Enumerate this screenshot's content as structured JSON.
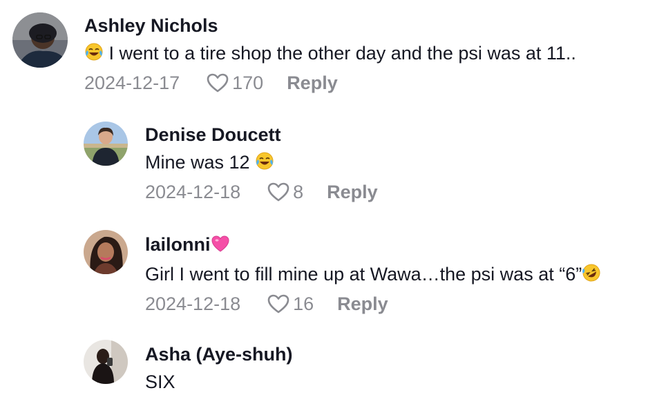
{
  "comments": [
    {
      "username": "Ashley Nichols",
      "text": "I went to a tire shop the other day and the psi was at 11..",
      "text_prefix_emoji": "face-with-tears-of-joy",
      "date": "2024-12-17",
      "likes": "170",
      "reply_label": "Reply"
    },
    {
      "username": "Denise Doucett",
      "text": "Mine was 12",
      "text_suffix_emoji": "face-with-tears-of-joy",
      "date": "2024-12-18",
      "likes": "8",
      "reply_label": "Reply"
    },
    {
      "username": "lailonni",
      "username_suffix_emoji": "pink-heart",
      "text": "Girl I went to fill mine up at Wawa…the psi was at “6”",
      "text_suffix_emoji": "rolling-on-the-floor-laughing",
      "date": "2024-12-18",
      "likes": "16",
      "reply_label": "Reply"
    },
    {
      "username": "Asha (Aye-shuh)",
      "text": "SIX"
    }
  ],
  "colors": {
    "text": "#161823",
    "secondary": "#8a8b91",
    "background": "#ffffff"
  }
}
